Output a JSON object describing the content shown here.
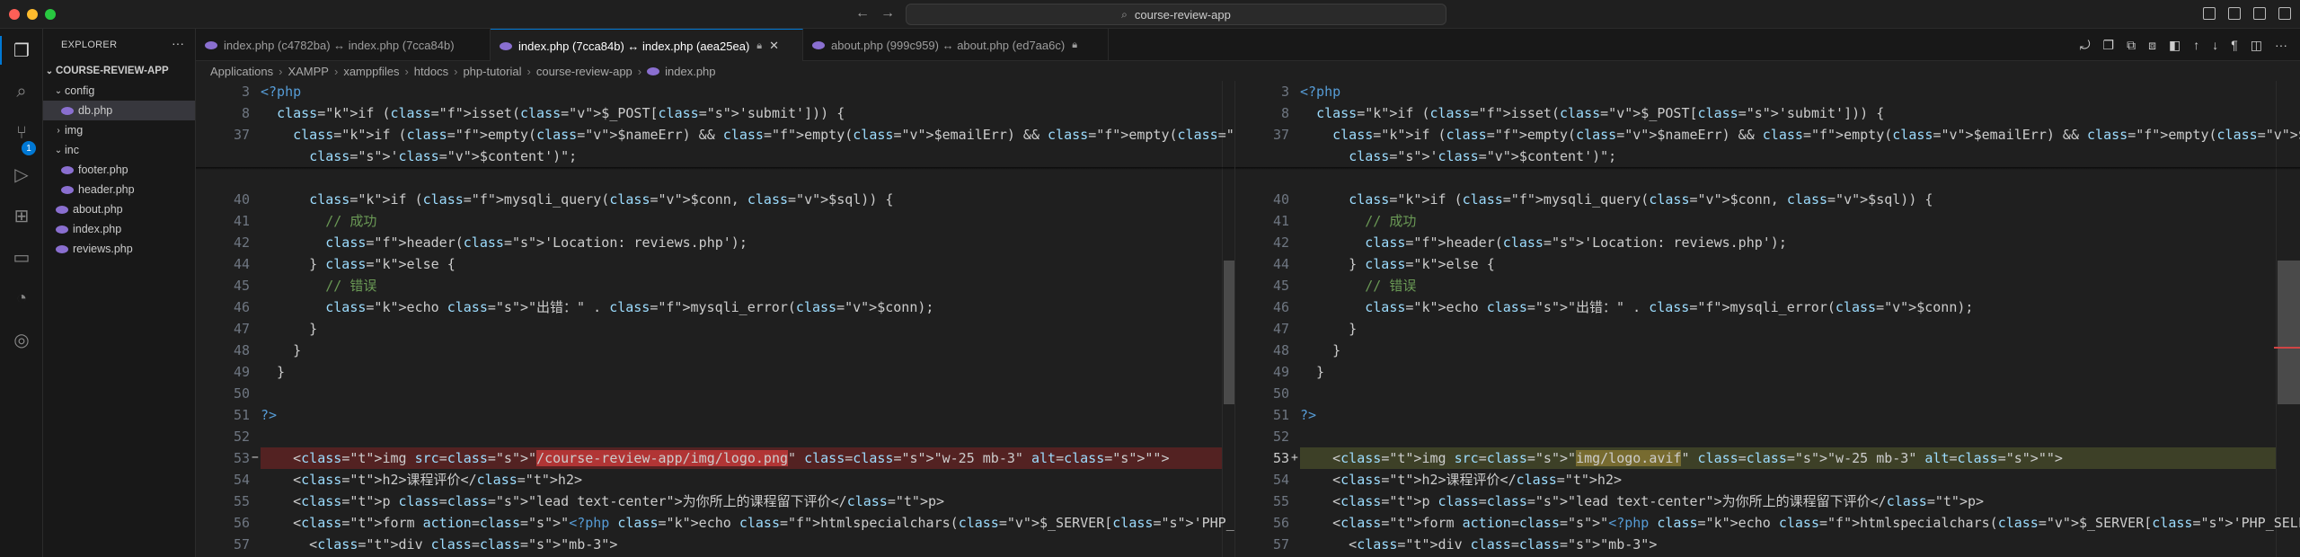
{
  "window": {
    "title": "course-review-app"
  },
  "explorer": {
    "header": "EXPLORER",
    "root": "COURSE-REVIEW-APP",
    "items": [
      {
        "label": "config",
        "type": "folder",
        "expanded": true,
        "depth": 1
      },
      {
        "label": "db.php",
        "type": "php",
        "depth": 2,
        "selected": true
      },
      {
        "label": "img",
        "type": "folder",
        "expanded": false,
        "depth": 1
      },
      {
        "label": "inc",
        "type": "folder",
        "expanded": true,
        "depth": 1
      },
      {
        "label": "footer.php",
        "type": "php",
        "depth": 2
      },
      {
        "label": "header.php",
        "type": "php",
        "depth": 2
      },
      {
        "label": "about.php",
        "type": "php",
        "depth": 1
      },
      {
        "label": "index.php",
        "type": "php",
        "depth": 1
      },
      {
        "label": "reviews.php",
        "type": "php",
        "depth": 1
      }
    ]
  },
  "activity": {
    "badge_count": "1"
  },
  "tabs": [
    {
      "label": "index.php (c4782ba) ↔ index.php (7cca84b)",
      "active": false
    },
    {
      "label": "index.php (7cca84b) ↔ index.php (aea25ea)",
      "active": true
    },
    {
      "label": "about.php (999c959) ↔ about.php (ed7aa6c)",
      "active": false
    }
  ],
  "breadcrumb": [
    "Applications",
    "XAMPP",
    "xamppfiles",
    "htdocs",
    "php-tutorial",
    "course-review-app",
    "index.php"
  ],
  "diff": {
    "left_current_line": "53",
    "right_current_line": "53",
    "lines": [
      {
        "no": "3",
        "left": "<?php",
        "right": "<?php"
      },
      {
        "no": "8",
        "left": "  if (isset($_POST['submit'])) {",
        "right": "  if (isset($_POST['submit'])) {"
      },
      {
        "no": "37",
        "left": "    if (empty($nameErr) && empty($emailErr) && empty($courseNameErr) && empty($contentErr)) {",
        "right": "    if (empty($nameErr) && empty($emailErr) && empty($courseNameErr) && empty($contentErr)) {"
      },
      {
        "no": "",
        "left": "      '$content')\";",
        "right": "      '$content')\";"
      },
      {
        "no": "40",
        "left": "      if (mysqli_query($conn, $sql)) {",
        "right": "      if (mysqli_query($conn, $sql)) {"
      },
      {
        "no": "41",
        "left": "        // 成功",
        "right": "        // 成功"
      },
      {
        "no": "42",
        "left": "        header('Location: reviews.php');",
        "right": "        header('Location: reviews.php');"
      },
      {
        "no": "44",
        "left": "      } else {",
        "right": "      } else {"
      },
      {
        "no": "45",
        "left": "        // 错误",
        "right": "        // 错误"
      },
      {
        "no": "46",
        "left": "        echo \"出错：\" . mysqli_error($conn);",
        "right": "        echo \"出错：\" . mysqli_error($conn);"
      },
      {
        "no": "47",
        "left": "      }",
        "right": "      }"
      },
      {
        "no": "48",
        "left": "    }",
        "right": "    }"
      },
      {
        "no": "49",
        "left": "  }",
        "right": "  }"
      },
      {
        "no": "50",
        "left": "",
        "right": ""
      },
      {
        "no": "51",
        "left": "?>",
        "right": "?>"
      },
      {
        "no": "52",
        "left": "",
        "right": ""
      },
      {
        "no": "53",
        "left": "    <img src=\"/course-review-app/img/logo.png\" class=\"w-25 mb-3\" alt=\"\">",
        "right": "    <img src=\"img/logo.avif\" class=\"w-25 mb-3\" alt=\"\">"
      },
      {
        "no": "54",
        "left": "    <h2>课程评价</h2>",
        "right": "    <h2>课程评价</h2>"
      },
      {
        "no": "55",
        "left": "    <p class=\"lead text-center\">为你所上的课程留下评价</p>",
        "right": "    <p class=\"lead text-center\">为你所上的课程留下评价</p>"
      },
      {
        "no": "56",
        "left": "    <form action=\"<?php echo htmlspecialchars($_SERVER['PHP_SELF']) ?>\" method=\"POST\"  class=\"mt-4 w-75\">",
        "right": "    <form action=\"<?php echo htmlspecialchars($_SERVER['PHP_SELF']) ?>\" method=\"POST\"  class=\"mt-4 w-75\">"
      },
      {
        "no": "57",
        "left": "      <div class=\"mb-3\">",
        "right": "      <div class=\"mb-3\">"
      }
    ]
  },
  "colors": {
    "accent": "#0078d4",
    "deleted": "#b42828",
    "inserted": "#8c963c"
  }
}
